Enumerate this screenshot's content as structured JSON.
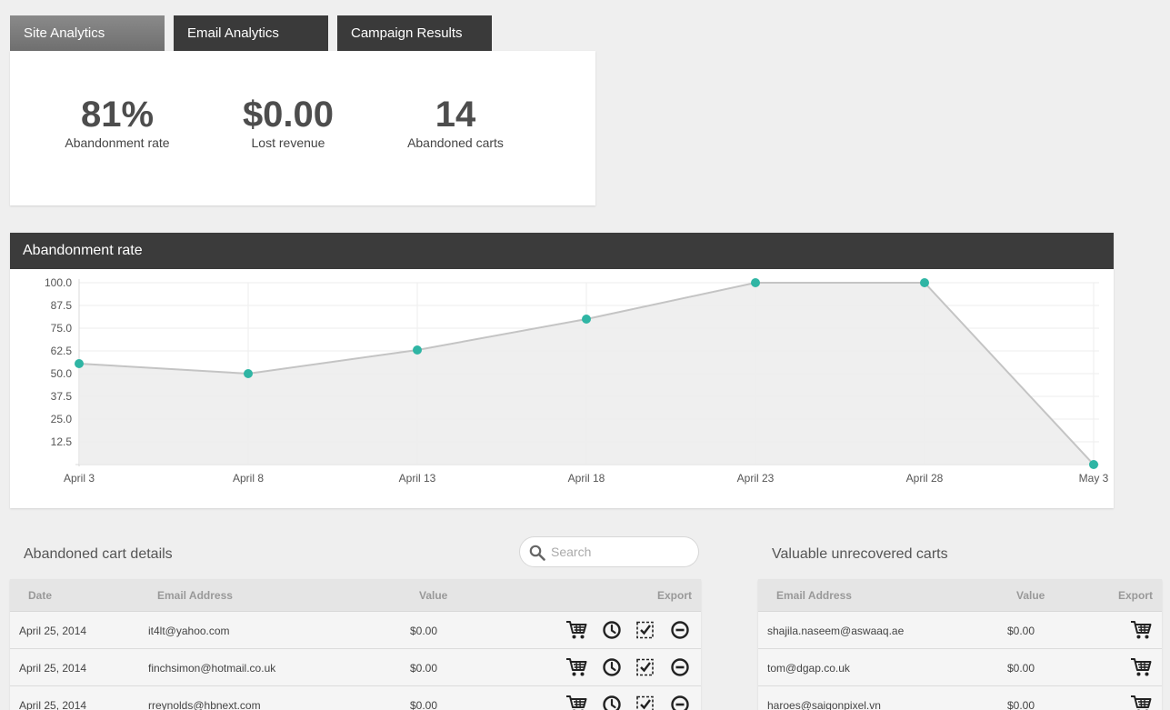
{
  "tabs": [
    {
      "label": "Site Analytics",
      "active": true
    },
    {
      "label": "Email Analytics",
      "active": false
    },
    {
      "label": "Campaign Results",
      "active": false
    }
  ],
  "stats": [
    {
      "value": "81%",
      "label": "Abandonment rate"
    },
    {
      "value": "$0.00",
      "label": "Lost revenue"
    },
    {
      "value": "14",
      "label": "Abandoned carts"
    }
  ],
  "chart_panel": {
    "title": "Abandonment rate"
  },
  "chart_data": {
    "type": "area",
    "x": [
      "April 3",
      "April 8",
      "April 13",
      "April 18",
      "April 23",
      "April 28",
      "May 3"
    ],
    "values": [
      55.5,
      50,
      63,
      80,
      100,
      100,
      0
    ],
    "yticks": [
      "100.0",
      "87.5",
      "75.0",
      "62.5",
      "50.0",
      "37.5",
      "25.0",
      "12.5"
    ],
    "ylim": [
      0,
      100
    ],
    "grid": true,
    "colors": {
      "line": "#c4c4c4",
      "fill": "#ececec",
      "point": "#2fb5a4"
    }
  },
  "details": {
    "title": "Abandoned cart details",
    "search_placeholder": "Search",
    "columns": {
      "date": "Date",
      "email": "Email Address",
      "value": "Value",
      "export": "Export"
    },
    "rows": [
      {
        "date": "April 25, 2014",
        "email": "it4lt@yahoo.com",
        "value": "$0.00"
      },
      {
        "date": "April 25, 2014",
        "email": "finchsimon@hotmail.co.uk",
        "value": "$0.00"
      },
      {
        "date": "April 25, 2014",
        "email": "rreynolds@hbnext.com",
        "value": "$0.00"
      }
    ]
  },
  "valuable": {
    "title": "Valuable unrecovered carts",
    "columns": {
      "email": "Email Address",
      "value": "Value",
      "export": "Export"
    },
    "rows": [
      {
        "email": "shajila.naseem@aswaaq.ae",
        "value": "$0.00"
      },
      {
        "email": "tom@dgap.co.uk",
        "value": "$0.00"
      },
      {
        "email": "haroes@saigonpixel.vn",
        "value": "$0.00"
      }
    ]
  }
}
